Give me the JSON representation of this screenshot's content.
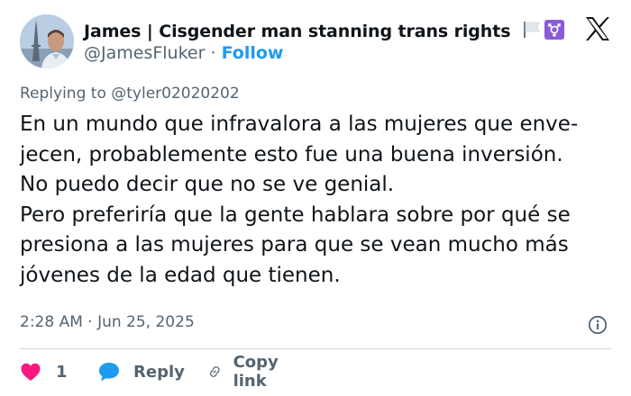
{
  "author": {
    "display_name": "James | Cisgender man stanning trans rights",
    "handle": "@JamesFluker",
    "separator": "·",
    "follow_label": "Follow"
  },
  "replying_to": "Replying to @tyler02020202",
  "tweet_lines": [
    "En un mundo que infravalora a las mujeres que enve-",
    "jecen, probablemente esto fue una buena inversión.",
    "No puedo decir que no se ve genial.",
    "Pero preferiría que la gente hablara sobre por qué se",
    "presiona a las mujeres para que se vean mucho más",
    "jóvenes de la edad que tienen."
  ],
  "timestamp": "2:28 AM · Jun 25, 2025",
  "actions": {
    "like_count": "1",
    "reply_label": "Reply",
    "copy_label": "Copy link"
  },
  "icons": {
    "avatar": "avatar-photo",
    "flags": [
      "white-flag-icon",
      "transgender-symbol-icon"
    ],
    "logo": "x-logo-icon",
    "info": "info-icon",
    "like": "heart-icon",
    "reply": "speech-bubble-icon",
    "copy": "link-icon"
  },
  "colors": {
    "accent": "#1d9bf0",
    "like": "#f91880",
    "secondary_text": "#536471",
    "primary_text": "#0f1419"
  }
}
